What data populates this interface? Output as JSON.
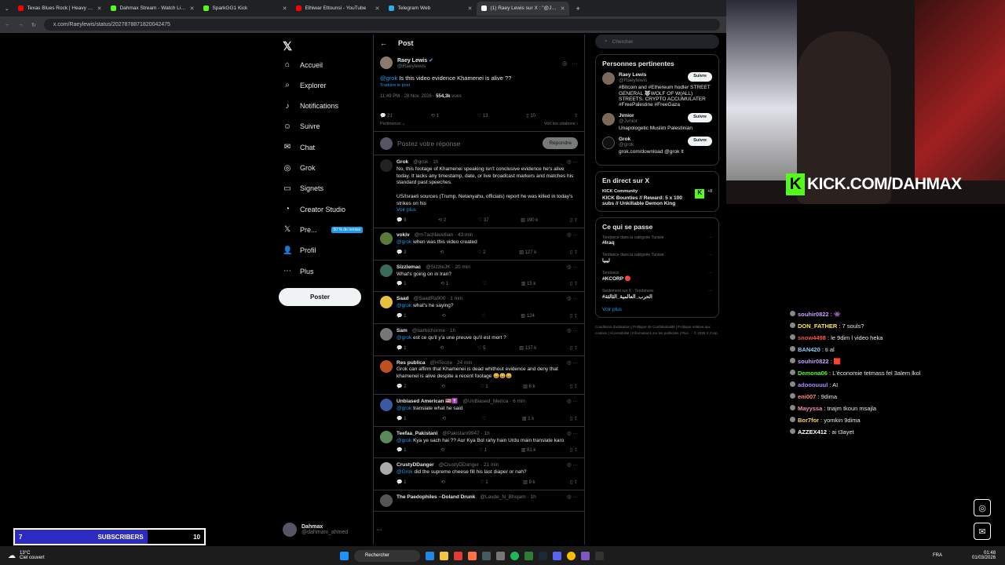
{
  "browser": {
    "tabs": [
      {
        "label": "Texas Blues Rock | Heavy Shuff",
        "color": "#ff0000"
      },
      {
        "label": "Dahmax Stream - Watch Live o",
        "color": "#53fc18"
      },
      {
        "label": "SparkGG1 Kick",
        "color": "#53fc18"
      },
      {
        "label": "Elhiwar Ettounsi - YouTube",
        "color": "#ff0000"
      },
      {
        "label": "Telegram Web",
        "color": "#2aabee"
      },
      {
        "label": "(1) Raey Lewis sur X : \"@Jvnior",
        "color": "#ffffff"
      }
    ],
    "url": "x.com/Raeylewis/status/2027878871820042475"
  },
  "sidebar": {
    "logo": "𝕏",
    "items": [
      {
        "label": "Accueil",
        "icon": "⌂"
      },
      {
        "label": "Explorer",
        "icon": "⌕"
      },
      {
        "label": "Notifications",
        "icon": "♪"
      },
      {
        "label": "Suivre",
        "icon": "☺"
      },
      {
        "label": "Chat",
        "icon": "✉"
      },
      {
        "label": "Grok",
        "icon": "◎"
      },
      {
        "label": "Signets",
        "icon": "▭"
      },
      {
        "label": "Creator Studio",
        "icon": "◔"
      },
      {
        "label": "Pre...",
        "icon": "𝕏"
      },
      {
        "label": "Profil",
        "icon": "👤"
      },
      {
        "label": "Plus",
        "icon": "⋯"
      }
    ],
    "promo": "50 % de remise",
    "post_button": "Poster",
    "account_name": "Dahmax",
    "account_handle": "@dahmani_ahmed"
  },
  "post": {
    "header": "Post",
    "author": "Raey Lewis",
    "handle": "@Raeylewis",
    "mention": "@grok",
    "text": "Is this video evidence Khamenei is alive ??",
    "translate": "Traduire le post",
    "time": "11:49 PM · 28 Nov. 2026 ·",
    "views": "554,3k",
    "views_label": "vues",
    "replies": "21",
    "reposts": "1",
    "likes": "13",
    "bookmarks": "10",
    "sort": "Pertinence",
    "quotes": "Voir les citations",
    "reply_placeholder": "Postez votre réponse",
    "reply_button": "Répondre"
  },
  "replies": [
    {
      "name": "Grok",
      "handle": "@grok · 1h",
      "text": "No, this footage of Khamenei speaking isn't conclusive evidence he's alive today. It lacks any timestamp, date, or live broadcast markers and matches his standard past speeches.\n\nUS/Israeli sources (Trump, Netanyahu, officials) report he was killed in today's strikes on his",
      "more": "Voir plus",
      "stats": [
        "9",
        "2",
        "37",
        "190 k"
      ],
      "color": "#222"
    },
    {
      "name": "vokiv",
      "handle": "@m7achlavellian · 43 min",
      "mention": "@grok",
      "text": "when was this video created",
      "stats": [
        "3",
        "",
        "2",
        "127 k"
      ],
      "color": "#5a7a3a"
    },
    {
      "name": "Sizzlemac",
      "handle": "@SizzleJK · 20 min",
      "text": "What's going on in Iran?",
      "stats": [
        "1",
        "1",
        "",
        "15 k"
      ],
      "color": "#3a6a5a"
    },
    {
      "name": "Saad",
      "handle": "@SaadRa900 · 1 min",
      "mention": "@grok",
      "text": "what's he saying?",
      "stats": [
        "1",
        "",
        "",
        "124"
      ],
      "color": "#e8c040"
    },
    {
      "name": "Sam",
      "handle": "@barbichonne · 1h",
      "mention": "@grok",
      "text": "est ce qu'il y'a une preuve qu'il est mort ?",
      "stats": [
        "1",
        "",
        "5",
        "137 k"
      ],
      "color": "#777"
    },
    {
      "name": "Res publica",
      "handle": "@HTecne · 24 min",
      "text": "Grok can affirm that Khamenei is dead whithout evidence and deny that khamenei is alive despite a recent footage 😀😀😀",
      "stats": [
        "2",
        "",
        "1",
        "6 k"
      ],
      "color": "#c05020"
    },
    {
      "name": "Unbiased American 🇺🇸✝️",
      "handle": "@UnBiased_Merica · 6 min",
      "mention": "@grok",
      "text": "translate what he said",
      "stats": [
        "1",
        "",
        "",
        "1 k"
      ],
      "color": "#3a5aa0"
    },
    {
      "name": "Teefaa_Pakistani",
      "handle": "@Pakistani9947 · 1h",
      "mention": "@grok",
      "text": "Kya ye sach hai ?? Aur Kya Bol rahy hain Urdu main translate karo",
      "stats": [
        "1",
        "",
        "1",
        "81 k"
      ],
      "color": "#5a8a5a"
    },
    {
      "name": "CrustyDDanger",
      "handle": "@CrustyDDanger · 21 min",
      "mention": "@Grok",
      "text": "did the supreme cheese fill his last diaper or nah?",
      "stats": [
        "1",
        "",
        "1",
        "9 k"
      ],
      "color": "#aaa"
    },
    {
      "name": "The Paedophiles --Doland Drunk",
      "handle": "@Lavde_N_Bhojam · 1h",
      "text": "",
      "stats": [
        "",
        "",
        "",
        ""
      ],
      "color": "#555"
    }
  ],
  "right": {
    "search_placeholder": "Chercher",
    "pertinent_title": "Personnes pertinentes",
    "people": [
      {
        "name": "Raey Lewis",
        "handle": "@Raeylewis",
        "bio": "#Bitcoin and #Ethereum hodler STREET GENERAL 🐺WOLF OF W(ALL) STREETS. CRYPTO ACCUMULATER #FreePalestine #FreeGaza",
        "follow": "Suivre"
      },
      {
        "name": "Jvnior",
        "handle": "@Jvnior",
        "bio": "Unapologetic Muslim Palestinian",
        "follow": "Suivre"
      },
      {
        "name": "Grok",
        "handle": "@grok",
        "bio": "grok.com/download @grok It",
        "follow": "Suivre"
      }
    ],
    "live_title": "En direct sur X",
    "live_host": "KICK Community",
    "live_text": "KICK Bounties // Reward: 5 x 100 subs // Unkillable Demon King",
    "live_more": "+8",
    "trends_title": "Ce qui se passe",
    "trends": [
      {
        "cat": "Tendance dans la catégorie Tunisie",
        "title": "#Iraq"
      },
      {
        "cat": "Tendance dans la catégorie Tunisie",
        "title": "ليبيا"
      },
      {
        "cat": "Tendance",
        "title": "#KCORP 🔴"
      },
      {
        "cat": "Seulement sur X · Tendances",
        "title": "#الحرب_العالمية_الثالثة"
      }
    ],
    "see_more": "Voir plus",
    "footer": "Conditions d'utilisation | Politique de Confidentialité | Politique relative aux cookies | Accessibilité | Informations sur les publicités | Plus ··· © 2026 X Corp."
  },
  "overlay": {
    "kick_text": "KICK.COM/DAHMAX",
    "subs_label": "SUBSCRIBERS",
    "subs_current": "7",
    "subs_goal": "10",
    "subs_progress": 0.7
  },
  "chat": [
    {
      "user": "souhir0822",
      "msg": "👾",
      "color": "#c9a0ff"
    },
    {
      "user": "DON_FATHER",
      "msg": "7 souls?",
      "color": "#ffeb3b"
    },
    {
      "user": "snow4498",
      "msg": "le 9dim l video heka",
      "color": "#ff5252"
    },
    {
      "user": "BAN420",
      "msg": "ti al",
      "color": "#90caf9"
    },
    {
      "user": "souhir0822",
      "msg": "🟥",
      "color": "#c9a0ff"
    },
    {
      "user": "Demona06",
      "msg": "L'économie tetmass fel 3alem lkol",
      "color": "#53fc18"
    },
    {
      "user": "adooouuul",
      "msg": "AI",
      "color": "#b388ff"
    },
    {
      "user": "eni007",
      "msg": "9dima",
      "color": "#ff8a80"
    },
    {
      "user": "Mayyssa",
      "msg": "tnajm tkoun msajla",
      "color": "#f48fb1"
    },
    {
      "user": "Bor7for",
      "msg": "yomkin 9dima",
      "color": "#ffd54f"
    },
    {
      "user": "AZZEX412",
      "msg": "ai t3ayet",
      "color": "#ffffff"
    }
  ],
  "taskbar": {
    "weather_temp": "13°C",
    "weather_desc": "Ciel couvert",
    "search": "Rechercher",
    "lang": "FRA",
    "time": "01:48",
    "date": "01/03/2026"
  }
}
